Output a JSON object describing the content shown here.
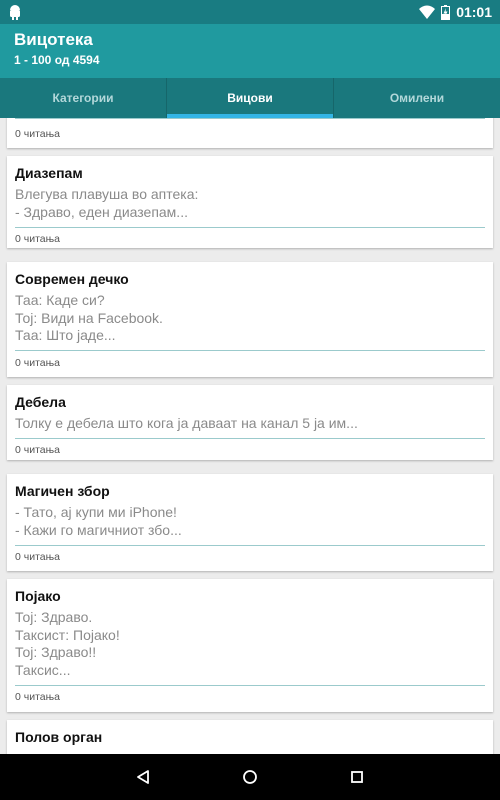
{
  "status": {
    "time": "01:01",
    "battery_icon": "battery-charging-icon",
    "wifi_icon": "wifi-icon",
    "notification_icon": "android-icon"
  },
  "appbar": {
    "title": "Вицотека",
    "subtitle": "1 - 100 од 4594"
  },
  "tabs": [
    {
      "label": "Категории",
      "active": false
    },
    {
      "label": "Вицови",
      "active": true
    },
    {
      "label": "Омилени",
      "active": false
    }
  ],
  "cards": [
    {
      "title": "",
      "body": "",
      "reads": "0 читања"
    },
    {
      "title": "Диазепам",
      "body": "Влегува плавуша во аптека:\n- Здраво, еден диазепам...",
      "reads": "0 читања"
    },
    {
      "title": "Современ дечко",
      "body": "Таа: Каде си?\nТој: Види на Facebook.\nТаа: Што јаде...",
      "reads": "0 читања"
    },
    {
      "title": "Дебела",
      "body": "Толку е дебела што кога ја даваат на канал 5 ја им...",
      "reads": "0 читања"
    },
    {
      "title": "Магичен збор",
      "body": "- Тато, ај купи ми iPhone!\n- Кажи го магичниот збо...",
      "reads": "0 читања"
    },
    {
      "title": "Појако",
      "body": "Тој: Здраво.\nТаксист: Појако!\nТој: Здраво!!\nТаксис...",
      "reads": "0 читања"
    },
    {
      "title": "Полов орган",
      "body": "",
      "reads": ""
    }
  ],
  "navbar": {
    "back_icon": "back-triangle-icon",
    "home_icon": "home-circle-icon",
    "recents_icon": "recents-square-icon"
  },
  "colors": {
    "statusbar": "#197c82",
    "appbar": "#209a9f",
    "tabbar": "#1a787d",
    "tab_indicator": "#33b5e5",
    "card_divider": "#9bcacc"
  }
}
